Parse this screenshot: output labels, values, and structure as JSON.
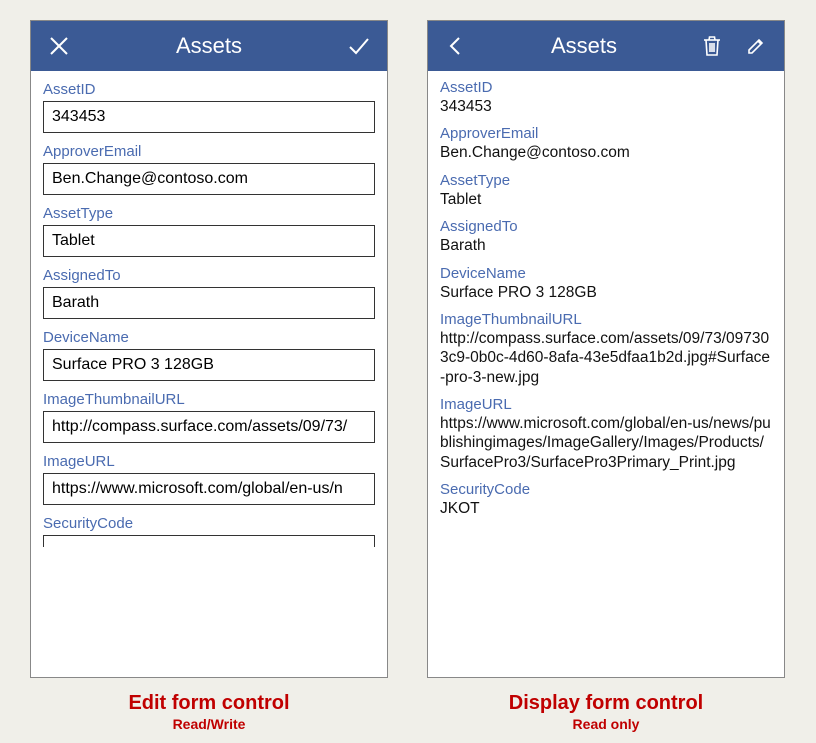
{
  "editForm": {
    "title": "Assets",
    "fields": [
      {
        "label": "AssetID",
        "value": "343453"
      },
      {
        "label": "ApproverEmail",
        "value": "Ben.Change@contoso.com"
      },
      {
        "label": "AssetType",
        "value": "Tablet"
      },
      {
        "label": "AssignedTo",
        "value": "Barath"
      },
      {
        "label": "DeviceName",
        "value": "Surface PRO 3 128GB"
      },
      {
        "label": "ImageThumbnailURL",
        "value": "http://compass.surface.com/assets/09/73/"
      },
      {
        "label": "ImageURL",
        "value": "https://www.microsoft.com/global/en-us/n"
      },
      {
        "label": "SecurityCode",
        "value": ""
      }
    ],
    "caption": {
      "title": "Edit form control",
      "subtitle": "Read/Write"
    }
  },
  "displayForm": {
    "title": "Assets",
    "fields": [
      {
        "label": "AssetID",
        "value": "343453"
      },
      {
        "label": "ApproverEmail",
        "value": "Ben.Change@contoso.com"
      },
      {
        "label": "AssetType",
        "value": "Tablet"
      },
      {
        "label": "AssignedTo",
        "value": "Barath"
      },
      {
        "label": "DeviceName",
        "value": "Surface PRO 3 128GB"
      },
      {
        "label": "ImageThumbnailURL",
        "value": "http://compass.surface.com/assets/09/73/097303c9-0b0c-4d60-8afa-43e5dfaa1b2d.jpg#Surface-pro-3-new.jpg"
      },
      {
        "label": "ImageURL",
        "value": "https://www.microsoft.com/global/en-us/news/publishingimages/ImageGallery/Images/Products/SurfacePro3/SurfacePro3Primary_Print.jpg"
      },
      {
        "label": "SecurityCode",
        "value": "JKOT"
      }
    ],
    "caption": {
      "title": "Display form control",
      "subtitle": "Read only"
    }
  }
}
